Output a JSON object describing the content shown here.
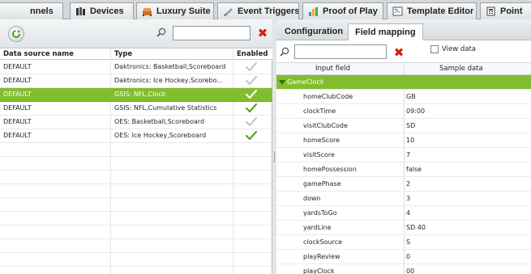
{
  "tabs": [
    {
      "label": "nnels",
      "icon": "none"
    },
    {
      "label": "Devices",
      "icon": "devices-icon"
    },
    {
      "label": "Luxury Suite",
      "icon": "luxury-suite-icon"
    },
    {
      "label": "Event Triggers",
      "icon": "event-triggers-icon"
    },
    {
      "label": "Proof of Play",
      "icon": "proof-of-play-icon"
    },
    {
      "label": "Template Editor",
      "icon": "template-editor-icon"
    },
    {
      "label": "Point",
      "icon": "point-icon"
    }
  ],
  "datasources": {
    "search_value": "",
    "columns": [
      "Data source name",
      "Type",
      "Enabled"
    ],
    "rows": [
      {
        "name": "DEFAULT",
        "type": "Daktronics: Basketball,Scoreboard",
        "enabled": "grey",
        "selected": false
      },
      {
        "name": "DEFAULT",
        "type": "Daktronics: Ice Hockey,Scorebo...",
        "enabled": "grey",
        "selected": false
      },
      {
        "name": "DEFAULT",
        "type": "GSIS: NFL,Clock",
        "enabled": "white",
        "selected": true
      },
      {
        "name": "DEFAULT",
        "type": "GSIS: NFL,Cumulative Statistics",
        "enabled": "green",
        "selected": false
      },
      {
        "name": "DEFAULT",
        "type": "OES: Basketball,Scoreboard",
        "enabled": "grey",
        "selected": false
      },
      {
        "name": "DEFAULT",
        "type": "OES: Ice Hockey,Scoreboard",
        "enabled": "green",
        "selected": false
      }
    ]
  },
  "detail": {
    "tabs": [
      "Configuration",
      "Field mapping"
    ],
    "active_tab": "Field mapping",
    "search_value": "",
    "view_data_label": "View data",
    "columns": [
      "Input field",
      "Sample data"
    ],
    "group": "GameClock",
    "fields": [
      {
        "field": "homeClubCode",
        "sample": "GB"
      },
      {
        "field": "clockTime",
        "sample": "09:00"
      },
      {
        "field": "visitClubCode",
        "sample": "SD"
      },
      {
        "field": "homeScore",
        "sample": "10"
      },
      {
        "field": "visitScore",
        "sample": "7"
      },
      {
        "field": "homePossession",
        "sample": "false"
      },
      {
        "field": "gamePhase",
        "sample": "2"
      },
      {
        "field": "down",
        "sample": "3"
      },
      {
        "field": "yardsToGo",
        "sample": "4"
      },
      {
        "field": "yardLine",
        "sample": "SD 40"
      },
      {
        "field": "clockSource",
        "sample": "S"
      },
      {
        "field": "playReview",
        "sample": "0"
      },
      {
        "field": "playClock",
        "sample": "00"
      }
    ]
  },
  "colors": {
    "selection": "#82bd2f",
    "delete": "#d21f0f",
    "enabled_check": "#5aa51e"
  }
}
